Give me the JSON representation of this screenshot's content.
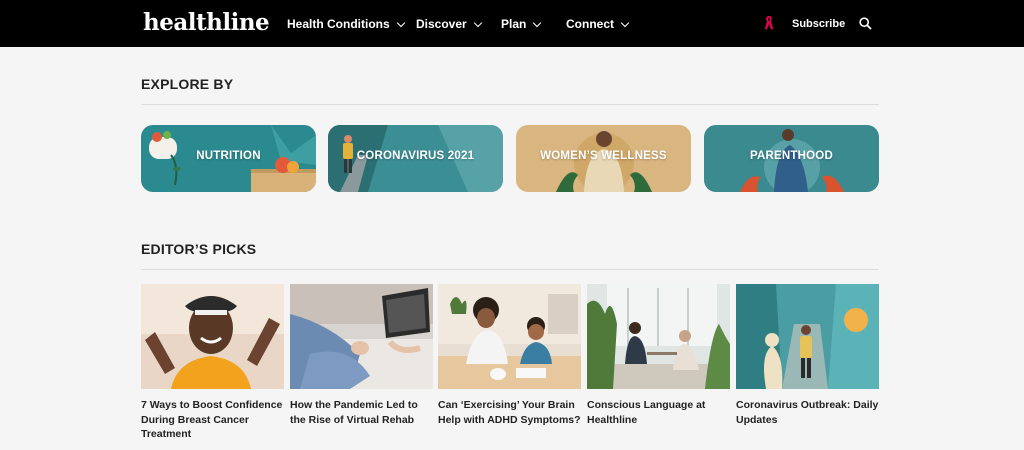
{
  "header": {
    "logo": "healthline",
    "nav": [
      {
        "label": "Health Conditions"
      },
      {
        "label": "Discover"
      },
      {
        "label": "Plan"
      },
      {
        "label": "Connect"
      }
    ],
    "subscribe_label": "Subscribe",
    "icons": {
      "ribbon": "awareness-ribbon-icon",
      "search": "search-icon",
      "chevron": "chevron-down-icon"
    }
  },
  "explore": {
    "title": "EXPLORE BY",
    "cards": [
      {
        "label": "NUTRITION",
        "color": "#2b8a8f"
      },
      {
        "label": "CORONAVIRUS 2021",
        "color": "#3c8e95"
      },
      {
        "label": "WOMEN’S WELLNESS",
        "color": "#d9b680"
      },
      {
        "label": "PARENTHOOD",
        "color": "#3a8a90"
      }
    ]
  },
  "editors_picks": {
    "title": "EDITOR’S PICKS",
    "items": [
      {
        "caption": "7 Ways to Boost Confidence During Breast Cancer Treatment"
      },
      {
        "caption": "How the Pandemic Led to the Rise of Virtual Rehab"
      },
      {
        "caption": "Can ‘Exercising’ Your Brain Help with ADHD Symptoms?"
      },
      {
        "caption": "Conscious Language at Healthline"
      },
      {
        "caption": "Coronavirus Outbreak: Daily Updates"
      }
    ]
  },
  "colors": {
    "header_bg": "#000000",
    "brand_pink": "#e2004f",
    "page_bg": "#f5f5f5",
    "teal": "#2e8b90"
  }
}
